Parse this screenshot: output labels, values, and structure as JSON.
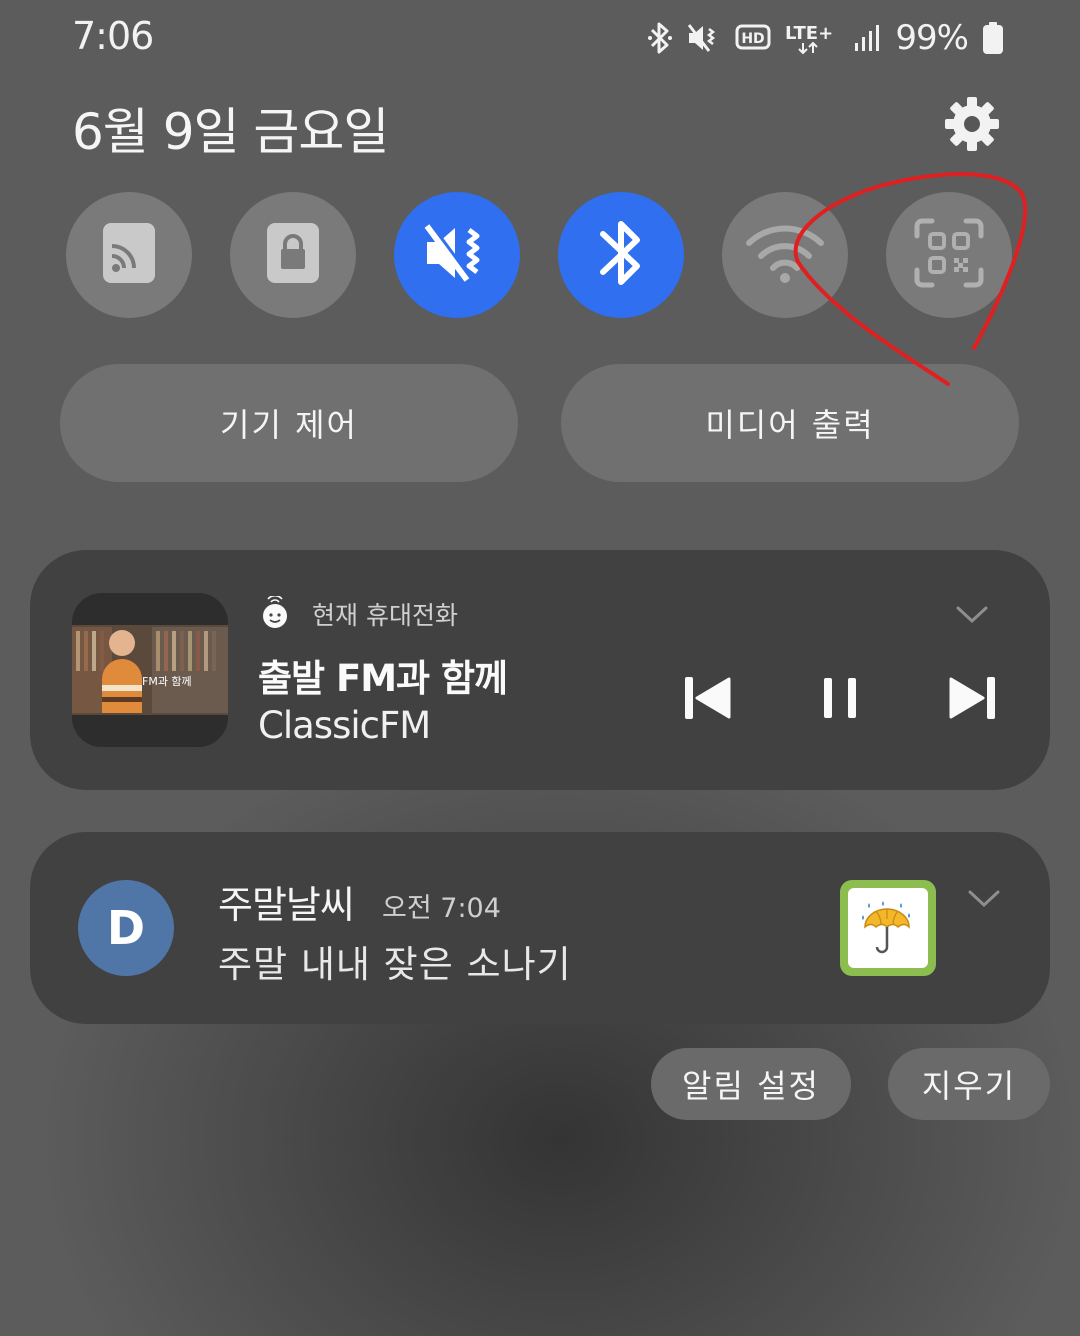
{
  "status_bar": {
    "time": "7:06",
    "network": "LTE+",
    "battery_percent": "99%",
    "icons": [
      "bluetooth-icon",
      "vibrate-mute-icon",
      "hd-voice-icon",
      "lte-plus-icon",
      "signal-icon",
      "battery-icon"
    ]
  },
  "header": {
    "date": "6월 9일 금요일",
    "settings_icon": "gear-icon"
  },
  "quick_tiles": [
    {
      "name": "cast",
      "icon": "cast-icon",
      "active": false
    },
    {
      "name": "secure-folder",
      "icon": "lock-icon",
      "active": false
    },
    {
      "name": "sound-mode",
      "icon": "vibrate-mute-icon",
      "active": true
    },
    {
      "name": "bluetooth",
      "icon": "bluetooth-icon",
      "active": true
    },
    {
      "name": "wifi",
      "icon": "wifi-icon",
      "active": false
    },
    {
      "name": "qr-scan",
      "icon": "qr-scan-icon",
      "active": false
    }
  ],
  "pills": {
    "device_control": "기기 제어",
    "media_output": "미디어 출력"
  },
  "media": {
    "source": "현재 휴대전화",
    "title": "출발 FM과 함께",
    "subtitle": "ClassicFM",
    "controls": [
      "previous-icon",
      "pause-icon",
      "next-icon"
    ]
  },
  "notification": {
    "avatar_letter": "D",
    "title": "주말날씨",
    "time": "오전 7:04",
    "body": "주말 내내 잦은 소나기"
  },
  "actions": {
    "notification_settings": "알림 설정",
    "clear": "지우기"
  },
  "colors": {
    "active_tile": "#2f6ff0",
    "inactive_tile": "#7a7a7a",
    "card": "#414141",
    "avatar": "#4f76a6",
    "annotation": "#e02020"
  }
}
